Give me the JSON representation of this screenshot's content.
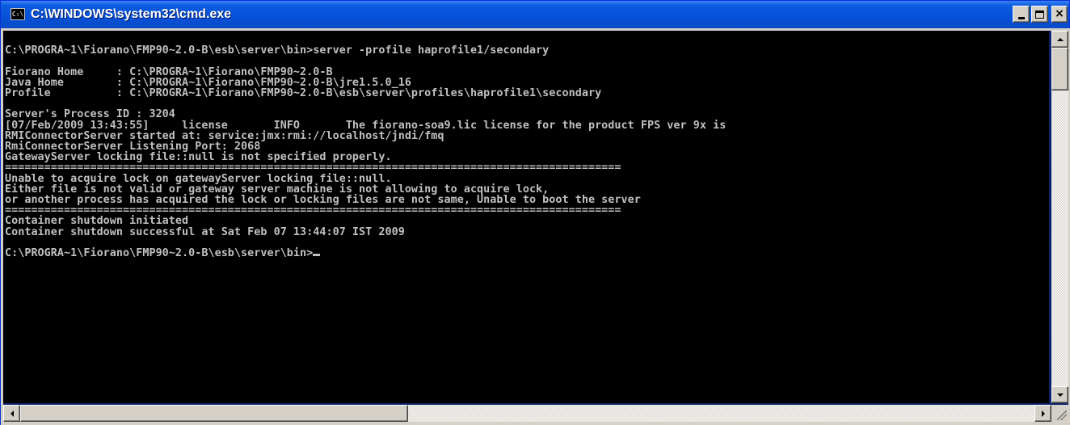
{
  "window": {
    "title": "C:\\WINDOWS\\system32\\cmd.exe",
    "icon": "console-app-icon",
    "icon_glyph": "C:\\",
    "buttons": {
      "minimize": "minimize-icon",
      "maximize": "maximize-icon",
      "close_glyph": "×"
    }
  },
  "console": {
    "lines": [
      "",
      "C:\\PROGRA~1\\Fiorano\\FMP90~2.0-B\\esb\\server\\bin>server -profile haprofile1/secondary",
      "",
      "Fiorano Home     : C:\\PROGRA~1\\Fiorano\\FMP90~2.0-B",
      "Java Home        : C:\\PROGRA~1\\Fiorano\\FMP90~2.0-B\\jre1.5.0_16",
      "Profile          : C:\\PROGRA~1\\Fiorano\\FMP90~2.0-B\\esb\\server\\profiles\\haprofile1\\secondary",
      "",
      "Server's Process ID : 3204",
      "[07/Feb/2009 13:43:55]     license       INFO       The fiorano-soa9.lic license for the product FPS ver 9x is",
      "RMIConnectorServer started at: service:jmx:rmi://localhost/jndi/fmq",
      "RmiConnectorServer Listening Port: 2068",
      "GatewayServer locking file::null is not specified properly.",
      "==============================================================================================",
      "Unable to acquire lock on gatewayServer locking file::null.",
      "Either file is not valid or gateway server machine is not allowing to acquire lock,",
      "or another process has acquired the lock or locking files are not same, Unable to boot the server",
      "==============================================================================================",
      "Container shutdown initiated",
      "Container shutdown successful at Sat Feb 07 13:44:07 IST 2009",
      "",
      "C:\\PROGRA~1\\Fiorano\\FMP90~2.0-B\\esb\\server\\bin>"
    ]
  },
  "colors": {
    "titlebar": "#0a5be0",
    "console_bg": "#000000",
    "console_fg": "#c0c0c0",
    "chrome": "#d4d0c8"
  }
}
